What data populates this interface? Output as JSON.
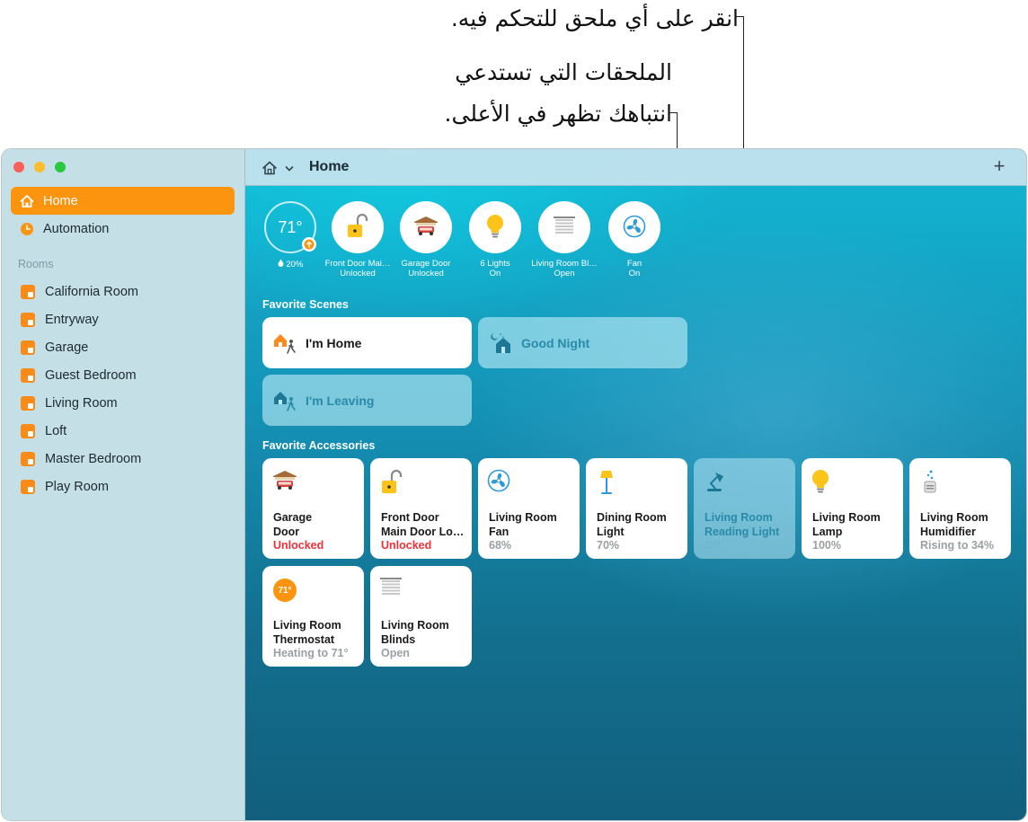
{
  "callouts": {
    "tap_accessory": "انقر على أي ملحق للتحكم فيه.",
    "attention_line1": "الملحقات التي تستدعي",
    "attention_line2": "انتباهك تظهر في الأعلى."
  },
  "sidebar": {
    "home_label": "Home",
    "automation_label": "Automation",
    "rooms_heading": "Rooms",
    "rooms": [
      "California Room",
      "Entryway",
      "Garage",
      "Guest Bedroom",
      "Living Room",
      "Loft",
      "Master Bedroom",
      "Play Room"
    ]
  },
  "toolbar": {
    "title": "Home",
    "add_label": "+"
  },
  "status": {
    "temperature": "71°",
    "humidity": "20%",
    "items": [
      {
        "name": "Front Door Mai…",
        "state": "Unlocked"
      },
      {
        "name": "Garage Door",
        "state": "Unlocked"
      },
      {
        "name": "6 Lights",
        "state": "On"
      },
      {
        "name": "Living Room Bl…",
        "state": "Open"
      },
      {
        "name": "Fan",
        "state": "On"
      }
    ]
  },
  "scenes": {
    "title": "Favorite Scenes",
    "items": [
      "I'm Home",
      "Good Night",
      "I'm Leaving"
    ]
  },
  "accessories": {
    "title": "Favorite Accessories",
    "items": [
      {
        "line1": "Garage",
        "line2": "Door",
        "status": "Unlocked"
      },
      {
        "line1": "Front Door",
        "line2": "Main Door Lo…",
        "status": "Unlocked"
      },
      {
        "line1": "Living Room",
        "line2": "Fan",
        "status": "68%"
      },
      {
        "line1": "Dining Room",
        "line2": "Light",
        "status": "70%"
      },
      {
        "line1": "Living Room",
        "line2": "Reading Light",
        "status": "Off"
      },
      {
        "line1": "Living Room",
        "line2": "Lamp",
        "status": "100%"
      },
      {
        "line1": "Living Room",
        "line2": "Humidifier",
        "status": "Rising to 34%"
      },
      {
        "line1": "Living Room",
        "line2": "Thermostat",
        "status": "Heating to 71°",
        "badge": "71°"
      },
      {
        "line1": "Living Room",
        "line2": "Blinds",
        "status": "Open"
      }
    ]
  },
  "colors": {
    "accent": "#fd9410",
    "alert": "#f0303a",
    "bulb": "#fcc419",
    "fan": "#2f9bd6"
  }
}
